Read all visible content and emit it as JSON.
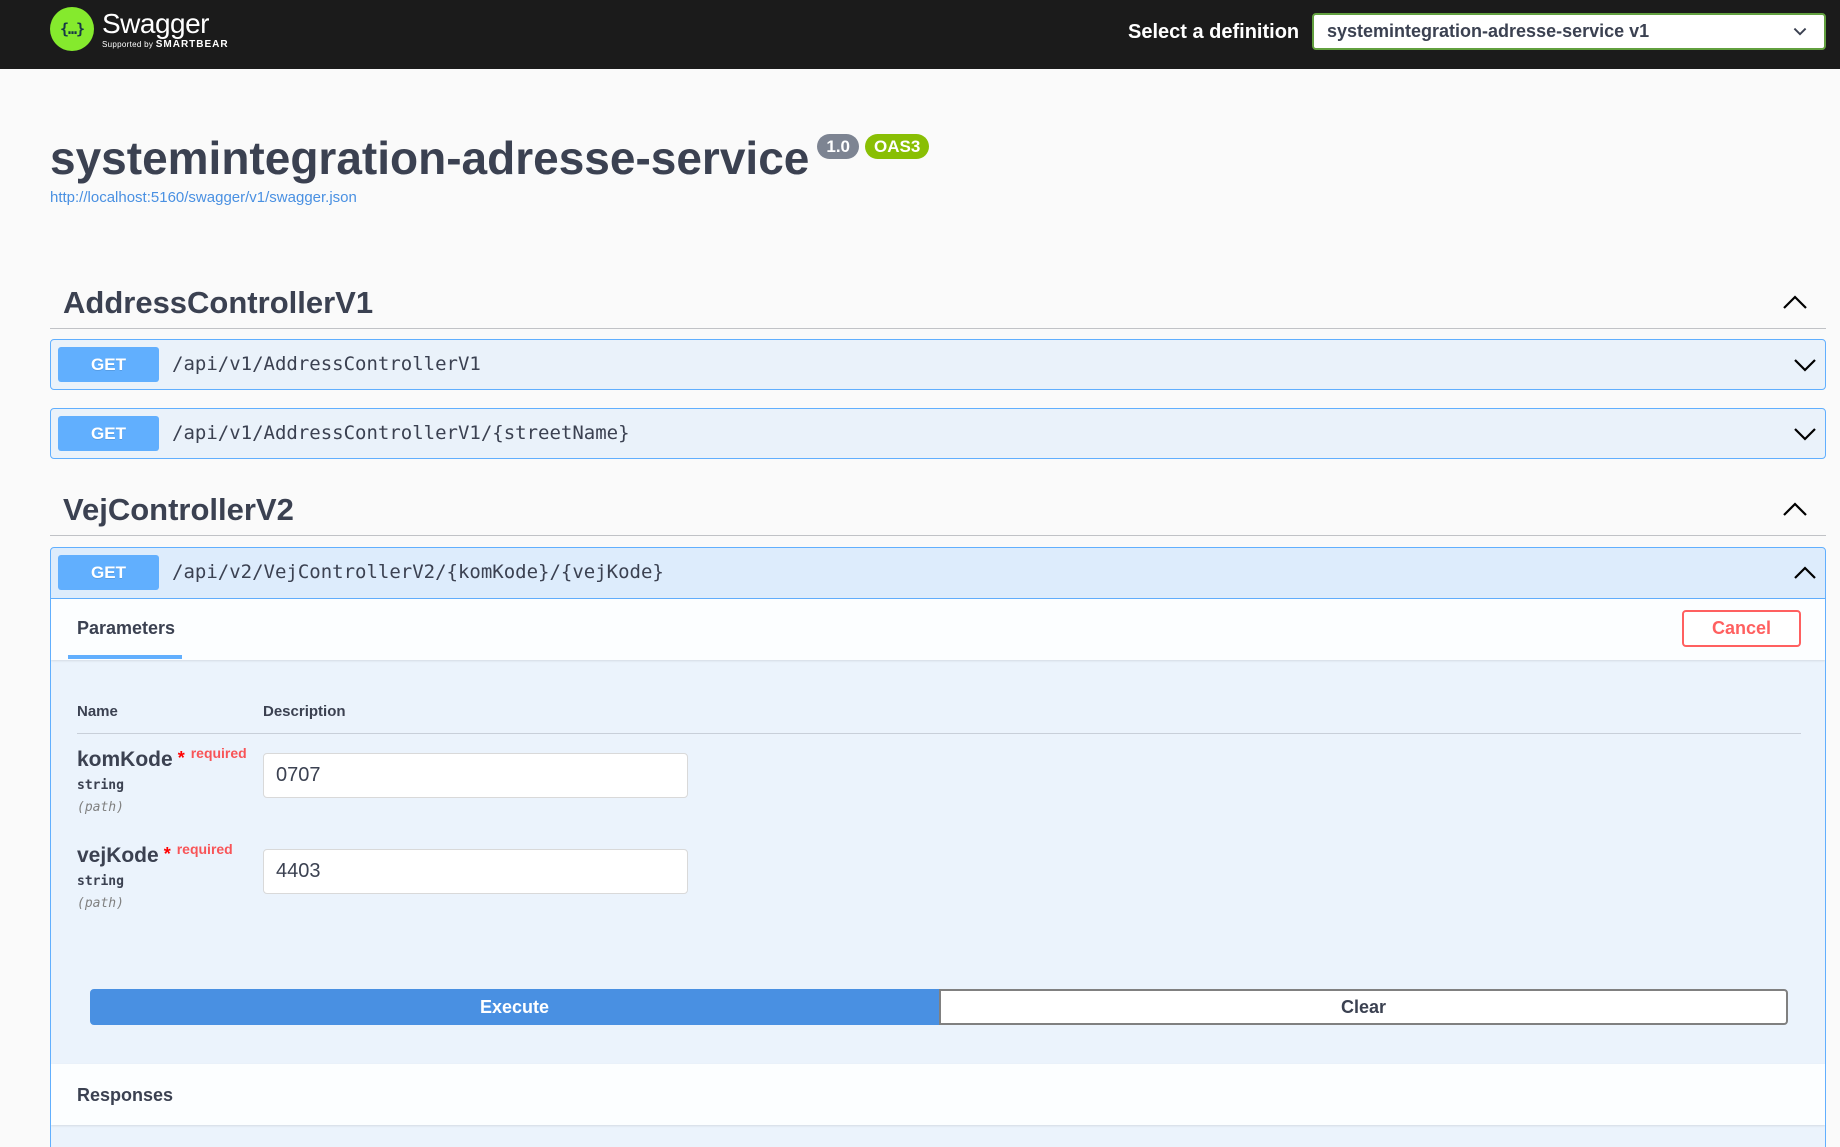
{
  "topbar": {
    "logo_glyph": "{…}",
    "logo_name": "Swagger",
    "logo_supported": "Supported by",
    "logo_company": "SMARTBEAR",
    "definition_label": "Select a definition",
    "definition_selected": "systemintegration-adresse-service v1"
  },
  "info": {
    "title": "systemintegration-adresse-service",
    "version": "1.0",
    "oas_badge": "OAS3",
    "spec_url": "http://localhost:5160/swagger/v1/swagger.json"
  },
  "tags": [
    {
      "name": "AddressControllerV1",
      "operations": [
        {
          "method": "GET",
          "path": "/api/v1/AddressControllerV1"
        },
        {
          "method": "GET",
          "path": "/api/v1/AddressControllerV1/{streetName}"
        }
      ]
    },
    {
      "name": "VejControllerV2",
      "operations": [
        {
          "method": "GET",
          "path": "/api/v2/VejControllerV2/{komKode}/{vejKode}"
        }
      ]
    }
  ],
  "expanded": {
    "tab_label": "Parameters",
    "cancel_label": "Cancel",
    "col_name": "Name",
    "col_description": "Description",
    "params": [
      {
        "name": "komKode",
        "star": "*",
        "required_label": "required",
        "type": "string",
        "in": "(path)",
        "value": "0707"
      },
      {
        "name": "vejKode",
        "star": "*",
        "required_label": "required",
        "type": "string",
        "in": "(path)",
        "value": "4403"
      }
    ],
    "execute_label": "Execute",
    "clear_label": "Clear",
    "responses_label": "Responses"
  },
  "colors": {
    "get_method": "#61affe",
    "logo_green": "#85ea2d",
    "oas_green": "#89bf04",
    "cancel_red": "#ff6060",
    "execute_blue": "#4990e2"
  },
  "icons": {
    "definition_select": "chevron-down-icon",
    "tag_toggle": "chevron-up-icon",
    "collapsed_op": "chevron-down-icon",
    "expanded_op": "chevron-up-icon"
  }
}
